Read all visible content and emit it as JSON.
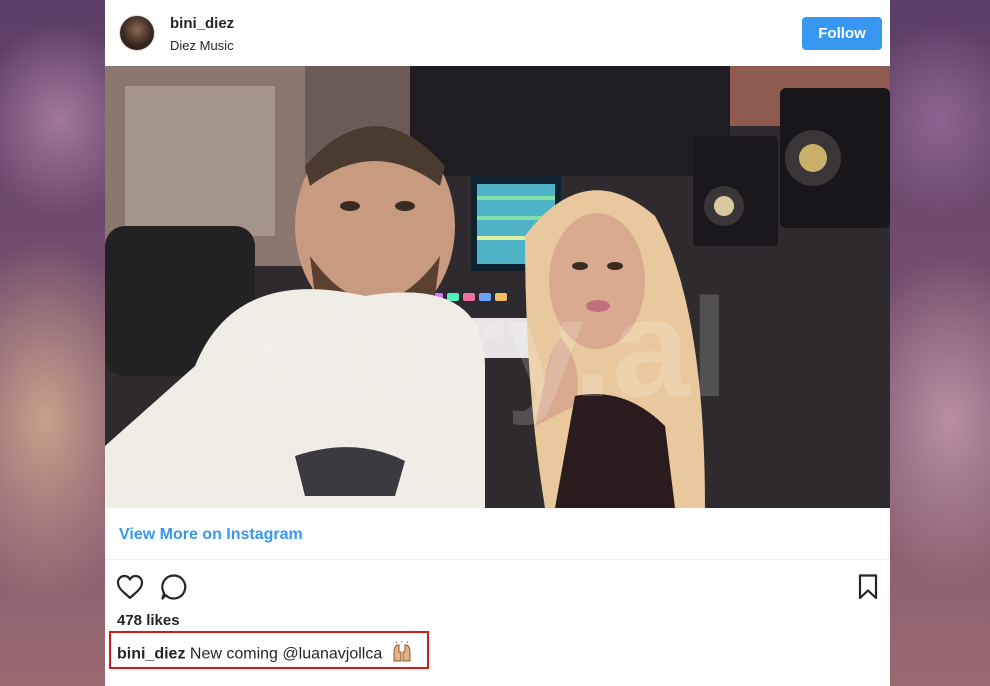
{
  "post": {
    "username": "bini_diez",
    "location": "Diez Music",
    "follow_label": "Follow",
    "view_more_label": "View More on Instagram",
    "likes_text": "478 likes",
    "caption": {
      "username": "bini_diez",
      "text": "New coming",
      "mention": "@luanavjollca",
      "emoji": "raised-hands-emoji"
    }
  },
  "photo": {
    "description_icon": "studio-selfie-photo",
    "watermark": "story.al"
  },
  "actions": {
    "like_icon": "heart-icon",
    "comment_icon": "comment-icon",
    "save_icon": "bookmark-icon"
  },
  "colors": {
    "accent": "#3897f0",
    "text": "#262626",
    "highlight_border": "#d11c1c"
  }
}
